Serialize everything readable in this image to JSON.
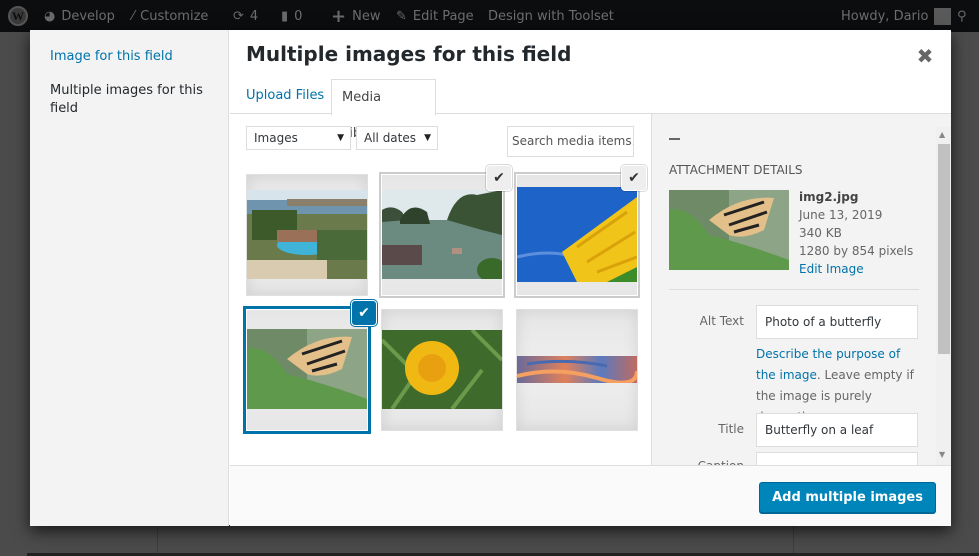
{
  "admin_bar": {
    "items": [
      {
        "icon": "wordpress-logo-icon",
        "label": ""
      },
      {
        "icon": "dashboard-icon",
        "label": "Develop"
      },
      {
        "icon": "paintbrush-icon",
        "label": "Customize"
      },
      {
        "icon": "updates-icon",
        "label": "4"
      },
      {
        "icon": "comments-icon",
        "label": "0"
      },
      {
        "icon": "plus-icon",
        "label": "New"
      },
      {
        "icon": "pencil-icon",
        "label": "Edit Page"
      },
      {
        "icon": "",
        "label": "Design with Toolset"
      }
    ],
    "greeting": "Howdy, Dario",
    "search_icon": "search-icon"
  },
  "modal": {
    "menu": [
      {
        "label": "Image for this field",
        "active": false
      },
      {
        "label": "Multiple images for this field",
        "active": true
      }
    ],
    "title": "Multiple images for this field",
    "close_icon": "close-icon",
    "tabs": [
      {
        "label": "Upload Files",
        "active": false
      },
      {
        "label": "Media Library",
        "active": true
      }
    ],
    "filters": {
      "type": {
        "value": "Images"
      },
      "date": {
        "value": "All dates"
      },
      "search": {
        "placeholder": "Search media items."
      }
    },
    "attachments": [
      {
        "subject": "resort pool by the sea",
        "selected": false,
        "details": false
      },
      {
        "subject": "bay with limestone karsts and boats",
        "selected": true,
        "details": false
      },
      {
        "subject": "sunflower against blue sky",
        "selected": true,
        "details": false
      },
      {
        "subject": "butterfly on a leaf",
        "selected": true,
        "details": true
      },
      {
        "subject": "yellow dandelion",
        "selected": false,
        "details": false
      },
      {
        "subject": "sunset clouds panorama",
        "selected": false,
        "details": false
      }
    ],
    "details": {
      "heading": "Attachment Details",
      "filename": "img2.jpg",
      "date": "June 13, 2019",
      "size": "340 KB",
      "dimensions": "1280 by 854 pixels",
      "edit_link": "Edit Image",
      "alt_label": "Alt Text",
      "alt_value": "Photo of a butterfly",
      "help_link": "Describe the purpose of the image",
      "help_text": ". Leave empty if the image is purely decorative.",
      "title_label": "Title",
      "title_value": "Butterfly on a leaf",
      "caption_label": "Caption"
    },
    "primary_button": "Add multiple images"
  }
}
